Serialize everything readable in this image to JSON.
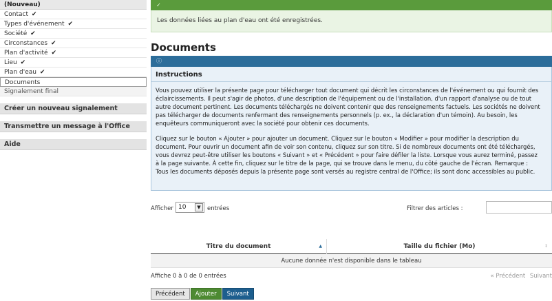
{
  "sidebar": {
    "heading": "(Nouveau)",
    "items": [
      {
        "label": "Contact",
        "check": "✔"
      },
      {
        "label": "Types d'événement",
        "check": "✔"
      },
      {
        "label": "Société",
        "check": "✔"
      },
      {
        "label": "Circonstances",
        "check": "✔"
      },
      {
        "label": "Plan d'activité",
        "check": "✔"
      },
      {
        "label": "Lieu",
        "check": "✔"
      },
      {
        "label": "Plan d'eau",
        "check": "✔"
      },
      {
        "label": "Documents",
        "check": ""
      },
      {
        "label": "Signalement final",
        "check": ""
      }
    ],
    "sections": [
      "Créer un nouveau signalement",
      "Transmettre un message à l'Office",
      "Aide"
    ]
  },
  "success": {
    "icon": "check-circle-icon",
    "message": "Les données liées au plan d'eau ont été enregistrées."
  },
  "page_title": "Documents",
  "instructions": {
    "icon": "info-circle-icon",
    "title": "Instructions",
    "lines": [
      "Vous pouvez utiliser la présente page pour télécharger tout document qui décrit les circonstances de l'événement ou qui fournit des",
      "éclaircissements. Il peut s'agir de photos, d'une description de l'équipement ou de l'installation, d'un rapport d'analyse ou de tout",
      "autre document pertinent. Les documents téléchargés ne doivent contenir que des renseignements factuels. Les sociétés ne doivent",
      "pas télécharger de documents renfermant des renseignements personnels (p. ex., la déclaration d'un témoin). Au besoin, les",
      "enquêteurs communiqueront avec la société pour obtenir ces documents."
    ],
    "lines2": [
      "Cliquez sur le bouton « Ajouter » pour ajouter un document. Cliquez sur le bouton « Modifier » pour modifier la description du",
      "document. Pour ouvrir un document afin de voir son contenu, cliquez sur son titre. Si de nombreux documents ont été téléchargés,",
      "vous devrez peut-être utiliser les boutons « Suivant » et « Précédent » pour faire défiler la liste. Lorsque vous aurez terminé, passez",
      "à la page suivante. À cette fin, cliquez sur le titre de la page, qui se trouve dans le menu, du côté gauche de l'écran. Remarque :",
      "Tous les documents déposés depuis la présente page sont versés au registre central de l'Office; ils sont donc accessibles au public."
    ]
  },
  "controls": {
    "show_label": "Afficher",
    "show_value": "10",
    "show_suffix": "entrées",
    "filter_label": "Filtrer des articles :",
    "filter_value": ""
  },
  "table": {
    "columns": [
      "Titre du document",
      "Taille du fichier (Mo)"
    ],
    "sort_up": "▲",
    "sort_both": "⇕",
    "empty": "Aucune donnée n'est disponible dans le tableau"
  },
  "footer": {
    "count": "Affiche 0 à 0 de 0 entrées",
    "prev": "« Précédent",
    "next": "Suivant"
  },
  "buttons": {
    "prev": "Précédent",
    "add": "Ajouter",
    "next": "Suivant"
  },
  "colors": {
    "success_bar": "#5a9b3c",
    "info_bar": "#2c6d9a",
    "add_button": "#4d8a32",
    "next_button": "#1d5e8e"
  }
}
